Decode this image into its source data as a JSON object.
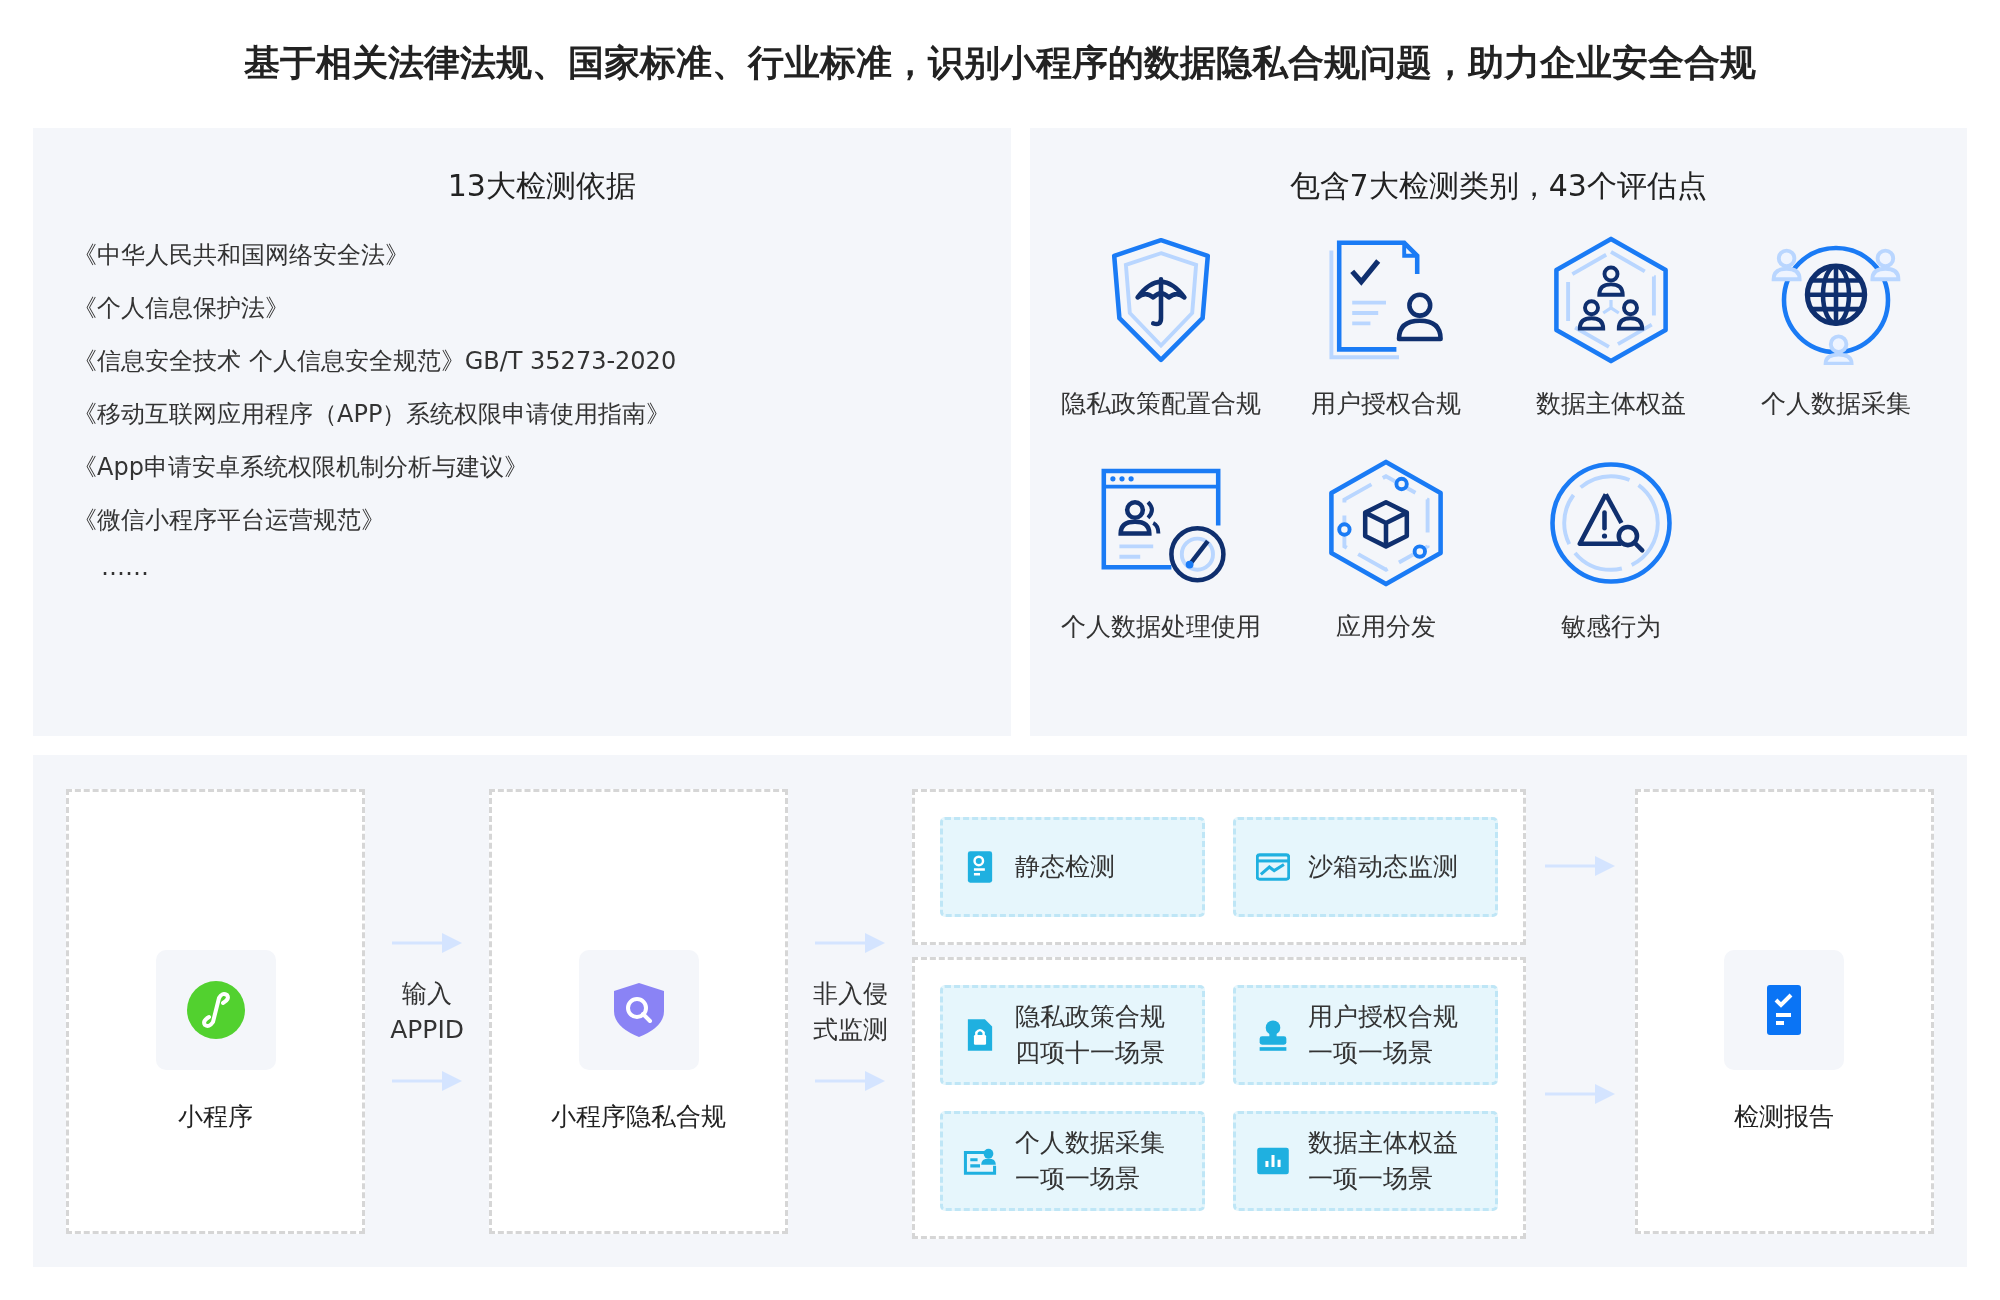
{
  "headline": "基于相关法律法规、国家标准、行业标准，识别小程序的数据隐私合规问题，助力企业安全合规",
  "basis": {
    "title": "13大检测依据",
    "items": [
      "《中华人民共和国网络安全法》",
      "《个人信息保护法》",
      "《信息安全技术 个人信息安全规范》GB/T 35273-2020",
      "《移动互联网应用程序（APP）系统权限申请使用指南》",
      "《App申请安卓系统权限机制分析与建议》",
      "《微信小程序平台运营规范》"
    ],
    "more": "……"
  },
  "categories": {
    "title": "包含7大检测类别，43个评估点",
    "items": [
      {
        "label": "隐私政策配置合规"
      },
      {
        "label": "用户授权合规"
      },
      {
        "label": "数据主体权益"
      },
      {
        "label": "个人数据采集"
      },
      {
        "label": "个人数据处理使用"
      },
      {
        "label": "应用分发"
      },
      {
        "label": "敏感行为"
      }
    ]
  },
  "flow": {
    "source": {
      "label": "小程序"
    },
    "input_step": {
      "lines": [
        "输入",
        "APPID"
      ]
    },
    "service": {
      "label": "小程序隐私合规"
    },
    "monitor_step": {
      "lines": [
        "非入侵",
        "式监测"
      ]
    },
    "methods": [
      {
        "lines": [
          "静态检测"
        ]
      },
      {
        "lines": [
          "沙箱动态监测"
        ]
      }
    ],
    "checks": [
      {
        "lines": [
          "隐私政策合规",
          "四项十一场景"
        ]
      },
      {
        "lines": [
          "用户授权合规",
          "一项一场景"
        ]
      },
      {
        "lines": [
          "个人数据采集",
          "一项一场景"
        ]
      },
      {
        "lines": [
          "数据主体权益",
          "一项一场景"
        ]
      }
    ],
    "result": {
      "label": "检测报告"
    }
  }
}
